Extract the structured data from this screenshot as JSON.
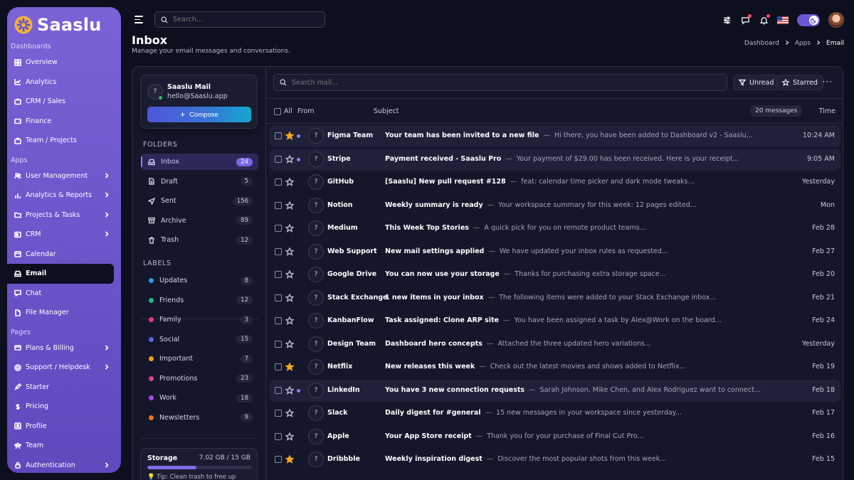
{
  "brand": {
    "name": "Saaslu"
  },
  "sidebar": {
    "sections": [
      {
        "title": "Dashboards",
        "items": [
          {
            "label": "Overview",
            "icon": "grid-icon",
            "chevron": false
          },
          {
            "label": "Analytics",
            "icon": "chart-line-icon",
            "chevron": false
          },
          {
            "label": "CRM / Sales",
            "icon": "crm-icon",
            "chevron": false
          },
          {
            "label": "Finance",
            "icon": "wallet-icon",
            "chevron": false
          },
          {
            "label": "Team / Projects",
            "icon": "briefcase-icon",
            "chevron": false
          }
        ]
      },
      {
        "title": "Apps",
        "items": [
          {
            "label": "User Management",
            "icon": "users-icon",
            "chevron": true
          },
          {
            "label": "Analytics & Reports",
            "icon": "bar-chart-icon",
            "chevron": true
          },
          {
            "label": "Projects & Tasks",
            "icon": "folder-icon",
            "chevron": true
          },
          {
            "label": "CRM",
            "icon": "contact-icon",
            "chevron": true
          },
          {
            "label": "Calendar",
            "icon": "calendar-icon",
            "chevron": false
          },
          {
            "label": "Email",
            "icon": "inbox-icon",
            "chevron": false,
            "active": true
          },
          {
            "label": "Chat",
            "icon": "chat-icon",
            "chevron": false
          },
          {
            "label": "File Manager",
            "icon": "file-icon",
            "chevron": false
          }
        ]
      },
      {
        "title": "Pages",
        "items": [
          {
            "label": "Plans & Billing",
            "icon": "card-icon",
            "chevron": true
          },
          {
            "label": "Support / Helpdesk",
            "icon": "support-icon",
            "chevron": true
          },
          {
            "label": "Starter",
            "icon": "rocket-icon",
            "chevron": false
          },
          {
            "label": "Pricing",
            "icon": "dollar-icon",
            "chevron": false
          },
          {
            "label": "Profile",
            "icon": "profile-icon",
            "chevron": false
          },
          {
            "label": "Team",
            "icon": "team-icon",
            "chevron": false
          },
          {
            "label": "Authentication",
            "icon": "lock-icon",
            "chevron": true
          }
        ]
      }
    ]
  },
  "topbar": {
    "search_placeholder": "Search..."
  },
  "page": {
    "title": "Inbox",
    "subtitle": "Manage your email messages and conversations."
  },
  "breadcrumb": [
    "Dashboard",
    "Apps",
    "Email"
  ],
  "account": {
    "avatar": "?",
    "name": "Saaslu Mail",
    "email": "hello@Saaslu.app",
    "compose_label": "Compose"
  },
  "folders_title": "FOLDERS",
  "folders": [
    {
      "label": "Inbox",
      "count": "24",
      "icon": "inbox-icon",
      "active": true
    },
    {
      "label": "Draft",
      "count": "5",
      "icon": "draft-icon"
    },
    {
      "label": "Sent",
      "count": "156",
      "icon": "send-icon"
    },
    {
      "label": "Archive",
      "count": "89",
      "icon": "archive-icon"
    },
    {
      "label": "Trash",
      "count": "12",
      "icon": "trash-icon"
    }
  ],
  "labels_title": "LABELS",
  "labels": [
    {
      "label": "Updates",
      "count": "8",
      "color": "#2f9be0"
    },
    {
      "label": "Friends",
      "count": "12",
      "color": "#1fb980"
    },
    {
      "label": "Family",
      "count": "3",
      "color": "#e0417a"
    },
    {
      "label": "Social",
      "count": "15",
      "color": "#5a62e8"
    },
    {
      "label": "Important",
      "count": "7",
      "color": "#f0a020"
    },
    {
      "label": "Promotions",
      "count": "23",
      "color": "#e0418f"
    },
    {
      "label": "Work",
      "count": "18",
      "color": "#9a4ee0"
    },
    {
      "label": "Newsletters",
      "count": "9",
      "color": "#f07020"
    }
  ],
  "storage": {
    "title": "Storage",
    "value": "7.02 GB / 15 GB",
    "used_fraction": 0.468,
    "tip": "💡 Tip: Clean trash to free up"
  },
  "mail": {
    "search_placeholder": "Search mail...",
    "filter_unread": "Unread",
    "filter_starred": "Starred",
    "more": "···",
    "columns": {
      "all": "All",
      "from": "From",
      "subject": "Subject",
      "count": "20 messages",
      "time": "Time"
    },
    "messages": [
      {
        "sender": "Figma Team",
        "subject": "Your team has been invited to a new file",
        "preview": "Hi there, you have been added to Dashboard v2 - Saaslu...",
        "time": "10:24 AM",
        "starred": true,
        "unread": true
      },
      {
        "sender": "Stripe",
        "subject": "Payment received - Saaslu Pro",
        "preview": "Your payment of $29.00 has been received. Here is your receipt...",
        "time": "9:05 AM",
        "starred": false,
        "unread": true
      },
      {
        "sender": "GitHub",
        "subject": "[Saaslu] New pull request #128",
        "preview": "feat: calendar time picker and dark mode tweaks...",
        "time": "Yesterday",
        "starred": false,
        "unread": false
      },
      {
        "sender": "Notion",
        "subject": "Weekly summary is ready",
        "preview": "Your workspace summary for this week: 12 pages edited...",
        "time": "Mon",
        "starred": false,
        "unread": false
      },
      {
        "sender": "Medium",
        "subject": "This Week Top Stories",
        "preview": "A quick pick for you on remote product teams...",
        "time": "Feb 28",
        "starred": false,
        "unread": false
      },
      {
        "sender": "Web Support",
        "subject": "New mail settings applied",
        "preview": "We have updated your inbox rules as requested...",
        "time": "Feb 27",
        "starred": false,
        "unread": false
      },
      {
        "sender": "Google Drive",
        "subject": "You can now use your storage",
        "preview": "Thanks for purchasing extra storage space...",
        "time": "Feb 20",
        "starred": false,
        "unread": false
      },
      {
        "sender": "Stack Exchange",
        "subject": "1 new items in your inbox",
        "preview": "The following items were added to your Stack Exchange inbox...",
        "time": "Feb 21",
        "starred": false,
        "unread": false
      },
      {
        "sender": "KanbanFlow",
        "subject": "Task assigned: Clone ARP site",
        "preview": "You have been assigned a task by Alex@Work on the board...",
        "time": "Feb 24",
        "starred": false,
        "unread": false
      },
      {
        "sender": "Design Team",
        "subject": "Dashboard hero concepts",
        "preview": "Attached the three updated hero variations...",
        "time": "Yesterday",
        "starred": false,
        "unread": false
      },
      {
        "sender": "Netflix",
        "subject": "New releases this week",
        "preview": "Check out the latest movies and shows added to Netflix...",
        "time": "Feb 19",
        "starred": true,
        "unread": false
      },
      {
        "sender": "LinkedIn",
        "subject": "You have 3 new connection requests",
        "preview": "Sarah Johnson, Mike Chen, and Alex Rodriguez want to connect...",
        "time": "Feb 18",
        "starred": false,
        "unread": true
      },
      {
        "sender": "Slack",
        "subject": "Daily digest for #general",
        "preview": "15 new messages in your workspace since yesterday...",
        "time": "Feb 17",
        "starred": false,
        "unread": false
      },
      {
        "sender": "Apple",
        "subject": "Your App Store receipt",
        "preview": "Thank you for your purchase of Final Cut Pro...",
        "time": "Feb 16",
        "starred": false,
        "unread": false
      },
      {
        "sender": "Dribbble",
        "subject": "Weekly inspiration digest",
        "preview": "Discover the most popular shots from this week...",
        "time": "Feb 15",
        "starred": true,
        "unread": false
      }
    ]
  }
}
